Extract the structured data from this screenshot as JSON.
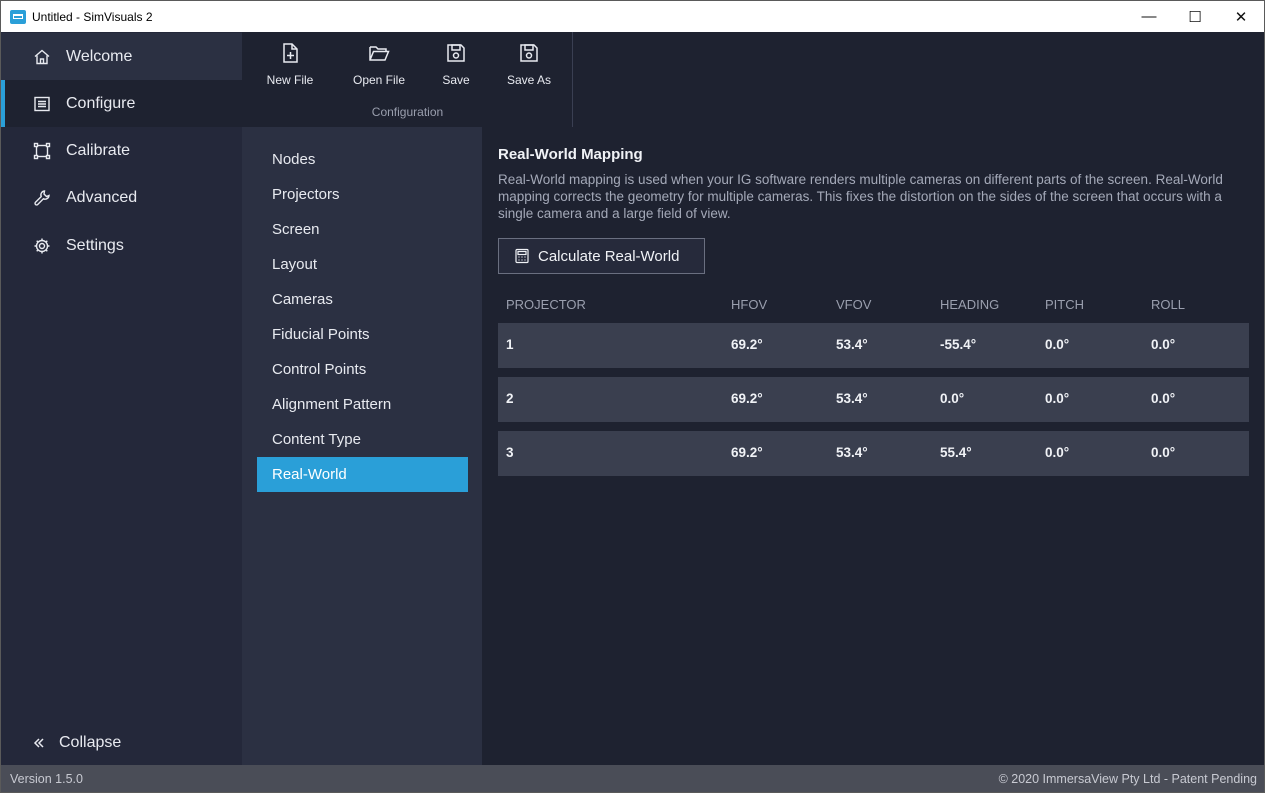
{
  "window": {
    "title": "Untitled - SimVisuals 2",
    "controls": {
      "minimize": "—",
      "maximize": "☐",
      "close": "✕"
    }
  },
  "nav": {
    "items": [
      {
        "label": "Welcome",
        "icon": "home-icon"
      },
      {
        "label": "Configure",
        "icon": "list-icon",
        "active": true
      },
      {
        "label": "Calibrate",
        "icon": "frame-icon"
      },
      {
        "label": "Advanced",
        "icon": "wrench-icon"
      },
      {
        "label": "Settings",
        "icon": "gear-icon"
      }
    ],
    "collapse_label": "Collapse"
  },
  "toolbar": {
    "new_file": "New File",
    "open_file": "Open File",
    "save": "Save",
    "save_as": "Save As",
    "group_label": "Configuration"
  },
  "submenu": {
    "items": [
      "Nodes",
      "Projectors",
      "Screen",
      "Layout",
      "Cameras",
      "Fiducial Points",
      "Control Points",
      "Alignment Pattern",
      "Content Type",
      "Real-World"
    ],
    "selected": "Real-World"
  },
  "main": {
    "title": "Real-World Mapping",
    "description": "Real-World mapping is used when your IG software renders multiple cameras on different parts of the screen. Real-World mapping corrects the geometry for multiple cameras. This fixes the distortion on the sides of the screen that occurs with a single camera and a large field of view.",
    "calc_button": "Calculate Real-World",
    "table": {
      "headers": [
        "PROJECTOR",
        "HFOV",
        "VFOV",
        "HEADING",
        "PITCH",
        "ROLL"
      ],
      "rows": [
        [
          "1",
          "69.2°",
          "53.4°",
          "-55.4°",
          "0.0°",
          "0.0°"
        ],
        [
          "2",
          "69.2°",
          "53.4°",
          "0.0°",
          "0.0°",
          "0.0°"
        ],
        [
          "3",
          "69.2°",
          "53.4°",
          "55.4°",
          "0.0°",
          "0.0°"
        ]
      ]
    }
  },
  "status": {
    "version": "Version 1.5.0",
    "copyright": "© 2020 ImmersaView Pty Ltd - Patent Pending"
  },
  "colors": {
    "accent": "#2a9fd8",
    "background": "#1e2230",
    "sidebar": "#24283a",
    "submenu": "#2b3042",
    "row": "#3a3f4f"
  }
}
